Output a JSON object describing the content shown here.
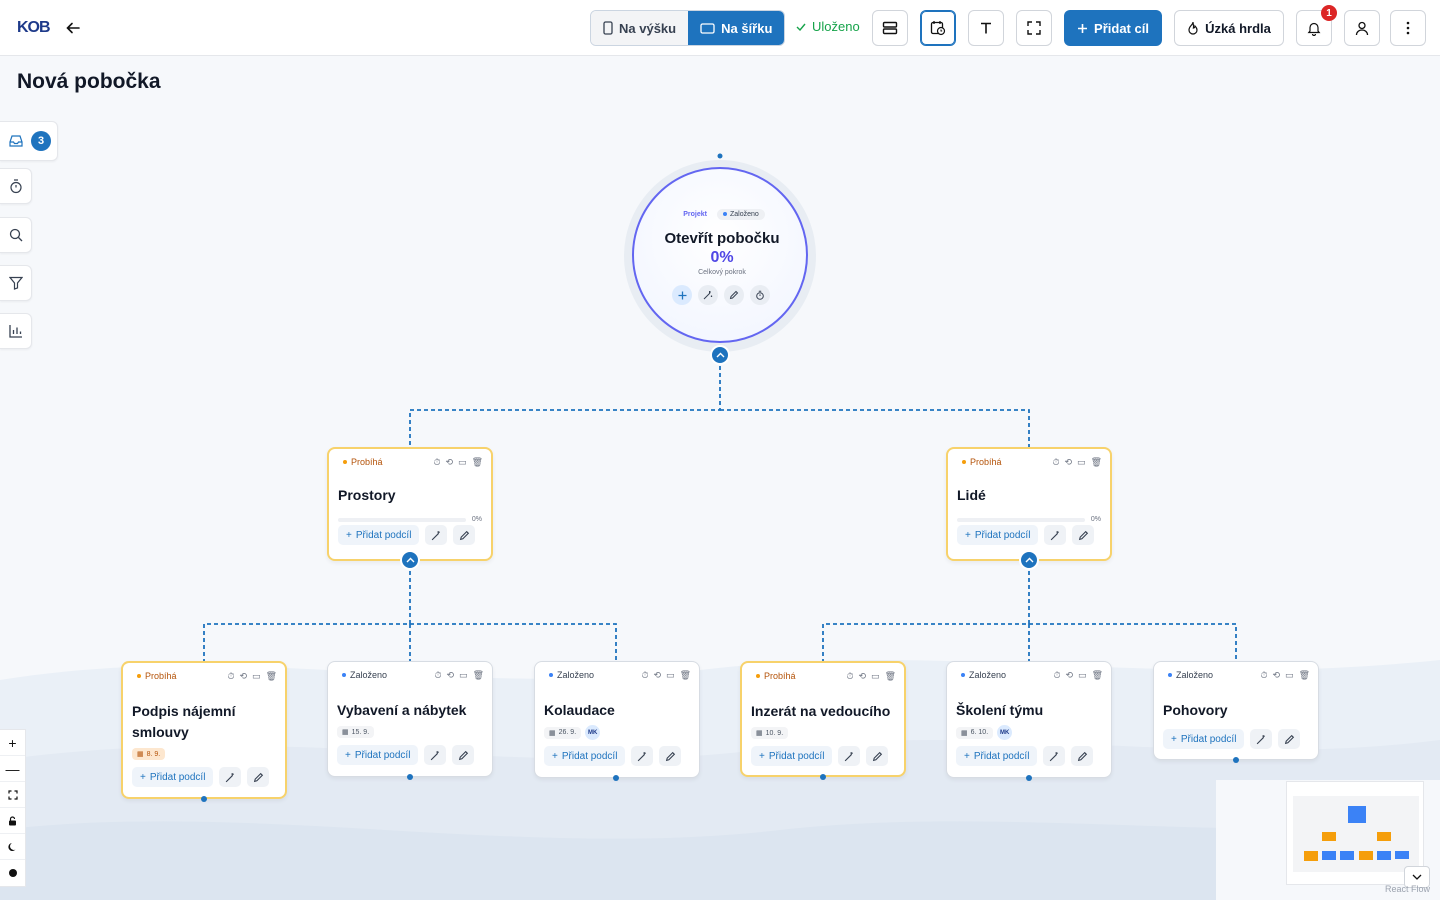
{
  "app": {
    "logo_text": "KOB",
    "page_title": "Nová pobočka"
  },
  "toolbar": {
    "portrait_label": "Na výšku",
    "landscape_label": "Na šířku",
    "saved_label": "Uloženo",
    "add_goal_label": "Přidat cíl",
    "bottlenecks_label": "Úzká hrdla",
    "notifications_count": "1"
  },
  "rail": {
    "inbox_count": "3"
  },
  "root": {
    "type_tag": "Projekt",
    "status_tag": "Založeno",
    "title": "Otevřít pobočku",
    "progress": "0%",
    "progress_label": "Celkový pokrok"
  },
  "goals": [
    {
      "status": "Probíhá",
      "title": "Prostory",
      "progress": "0%",
      "add_label": "Přidat podcíl"
    },
    {
      "status": "Probíhá",
      "title": "Lidé",
      "progress": "0%",
      "add_label": "Přidat podcíl"
    }
  ],
  "subgoals": [
    {
      "status": "Probíhá",
      "title": "Podpis nájemní smlouvy",
      "date": "8. 9.",
      "add_label": "Přidat podcíl"
    },
    {
      "status": "Založeno",
      "title": "Vybavení a nábytek",
      "date": "15. 9.",
      "add_label": "Přidat podcíl"
    },
    {
      "status": "Založeno",
      "title": "Kolaudace",
      "date": "26. 9.",
      "assignee": "MK",
      "add_label": "Přidat podcíl"
    },
    {
      "status": "Probíhá",
      "title": "Inzerát na vedoucího",
      "date": "10. 9.",
      "add_label": "Přidat podcíl"
    },
    {
      "status": "Založeno",
      "title": "Školení týmu",
      "date": "6. 10.",
      "assignee": "MK",
      "add_label": "Přidat podcíl"
    },
    {
      "status": "Založeno",
      "title": "Pohovory",
      "add_label": "Přidat podcíl"
    }
  ],
  "watermark": "React Flow",
  "colors": {
    "accent": "#1e73be",
    "running_border": "#f7d26b",
    "running_text": "#b45309",
    "created_dot": "#3b82f6",
    "root_ring": "#6366f1",
    "saved": "#16a34a"
  },
  "icons": [
    "back-arrow-icon",
    "smartphone-icon",
    "tablet-icon",
    "check-icon",
    "rows-icon",
    "calendar-clock-icon",
    "text-icon",
    "fullscreen-icon",
    "plus-icon",
    "flame-icon",
    "bell-icon",
    "user-icon",
    "more-vertical-icon",
    "inbox-icon",
    "timer-icon",
    "search-icon",
    "filter-icon",
    "bar-chart-icon",
    "wand-icon",
    "pencil-icon",
    "refresh-icon",
    "trash-icon",
    "calendar-icon",
    "chevron-up-icon",
    "chevron-down-icon",
    "zoom-in-icon",
    "zoom-out-icon",
    "fit-view-icon",
    "lock-icon",
    "moon-icon",
    "palette-icon"
  ]
}
